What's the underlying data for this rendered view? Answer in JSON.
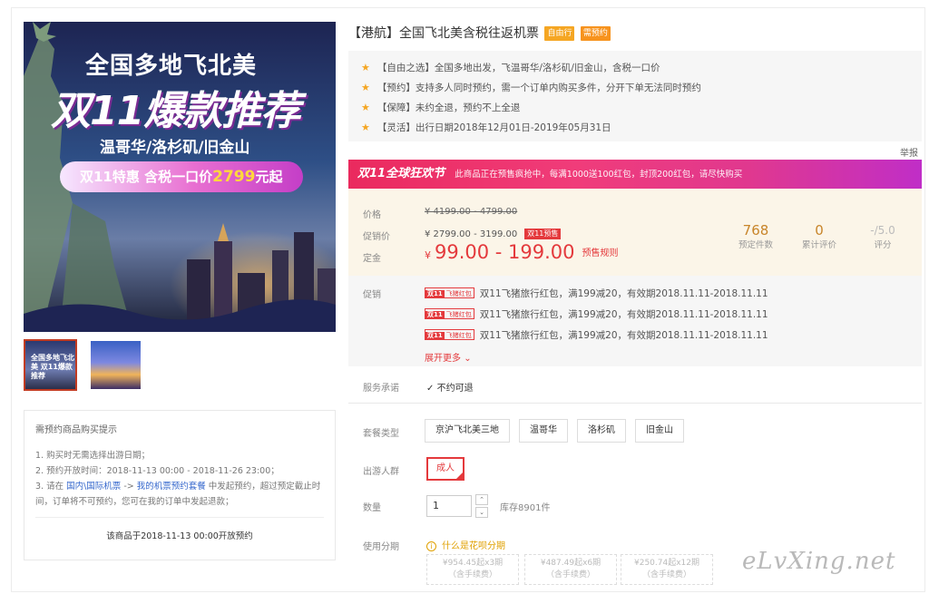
{
  "hero": {
    "line1": "全国多地飞北美",
    "line2": "双11爆款推荐",
    "line3": "温哥华/洛杉矶/旧金山",
    "badge_prefix": "双11特惠  含税一口价",
    "badge_price": "2799",
    "badge_suffix": "元起"
  },
  "thumbnails": [
    {
      "label": "全国多地飞北美 双11爆款推荐",
      "selected": true
    },
    {
      "label": "",
      "selected": false
    }
  ],
  "tips": {
    "title": "需预约商品购买提示",
    "item1": "1. 购买时无需选择出游日期；",
    "item2": "2. 预约开放时间：2018-11-13 00:00 - 2018-11-26 23:00；",
    "item3_a": "3. 请在 ",
    "item3_link1": "国内\\国际机票",
    "item3_b": " -> ",
    "item3_link2": "我的机票预约套餐",
    "item3_c": " 中发起预约，超过预定截止时间，订单将不可预约，您可在我的订单中发起退款；",
    "open_time": "该商品于2018-11-13 00:00开放预约"
  },
  "product": {
    "title": "【港航】全国飞北美含税往返机票",
    "tag1": "自由行",
    "tag2": "需预约",
    "features": [
      "【自由之选】全国多地出发，飞温哥华/洛杉矶/旧金山，含税一口价",
      "【预约】支持多人同时预约，需一个订单内购买多件，分开下单无法同时预约",
      "【保障】未约全退，预约不上全退",
      "【灵活】出行日期2018年12月01日-2019年05月31日"
    ],
    "report": "举报"
  },
  "banner": {
    "title": "双11全球狂欢节",
    "text": "此商品正在预售疯抢中，每满1000送100红包，封顶200红包，请尽快购买"
  },
  "price": {
    "price_label": "价格",
    "price_value": "¥ 4199.00 - 4799.00",
    "promo_label": "促销价",
    "promo_value": "¥ 2799.00 - 3199.00",
    "promo_tag": "双11预售",
    "deposit_label": "定金",
    "deposit_currency": "¥",
    "deposit_value": "99.00 - 199.00",
    "presale_rule": "预售规则"
  },
  "stats": {
    "booked_value": "768",
    "booked_label": "预定件数",
    "reviews_value": "0",
    "reviews_label": "累计评价",
    "rating_value": "-/5.0",
    "rating_label": "评分"
  },
  "promotions": {
    "label": "促销",
    "tag_bold": "双11",
    "tag_text": "飞猪红包",
    "items": [
      "双11飞猪旅行红包，满199减20，有效期2018.11.11-2018.11.11",
      "双11飞猪旅行红包，满199减20，有效期2018.11.11-2018.11.11",
      "双11飞猪旅行红包，满199减20，有效期2018.11.11-2018.11.11"
    ],
    "expand": "展开更多"
  },
  "service": {
    "label": "服务承诺",
    "value": "不约可退"
  },
  "package": {
    "label": "套餐类型",
    "options": [
      "京沪飞北美三地",
      "温哥华",
      "洛杉矶",
      "旧金山"
    ]
  },
  "traveler": {
    "label": "出游人群",
    "option": "成人"
  },
  "quantity": {
    "label": "数量",
    "value": "1",
    "up": "⌃",
    "down": "⌄",
    "stock": "库存8901件"
  },
  "installment": {
    "label": "使用分期",
    "help": "什么是花呗分期",
    "plans": [
      {
        "line1": "¥954.45起x3期",
        "line2": "（含手续费）"
      },
      {
        "line1": "¥487.49起x6期",
        "line2": "（含手续费）"
      },
      {
        "line1": "¥250.74起x12期",
        "line2": "（含手续费）"
      }
    ]
  },
  "watermark": "eLvXing.net"
}
